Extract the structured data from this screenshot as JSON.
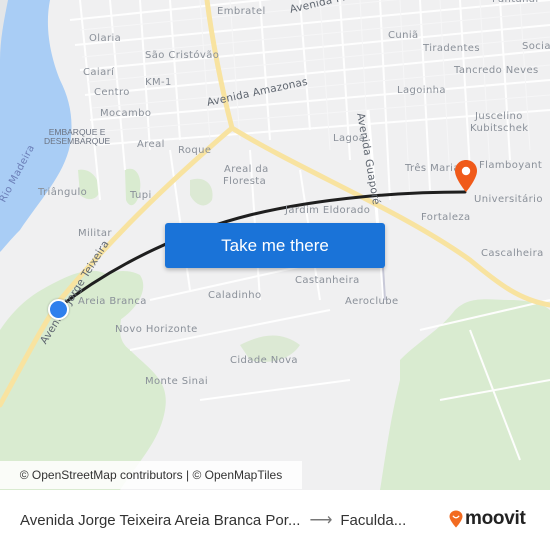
{
  "map": {
    "colors": {
      "background": "#f0f0f1",
      "water": "#a9cdf5",
      "park": "#d9ebd0",
      "major_road": "#f8e3a0",
      "route_line": "#1f1f1f",
      "origin_marker": "#2f80ed",
      "destination_marker": "#f05a1a",
      "button": "#1a73d8"
    },
    "labels": {
      "embratel": "Embratel",
      "av_pinheiro_machado": "Avenida Pinheiro Machado",
      "pantanal": "Pantanal",
      "olaria": "Olaria",
      "sao_cristovao": "São Cristóvão",
      "caiari": "Caiarí",
      "km1": "KM-1",
      "centro": "Centro",
      "av_amazonas": "Avenida Amazonas",
      "mocambo": "Mocambo",
      "embarque": "EMBARQUE E\nDESEMBARQUE",
      "areal": "Areal",
      "roque": "Roque",
      "cunia": "Cuniã",
      "tiradentes": "Tiradentes",
      "socia": "Socia",
      "tancredo_neves": "Tancredo Neves",
      "lagoinha": "Lagoinha",
      "juscelino": "Juscelino",
      "kubitschek": "Kubitschek",
      "lagoa": "Lagoa",
      "av_guapore": "Avenida Guaporé",
      "rio_madeira": "Rio Madeira",
      "triangulo": "Triângulo",
      "tupi": "Tupi",
      "areal_da": "Areal da",
      "floresta": "Floresta",
      "tres_marias": "Três Marias",
      "flamboyant": "Flamboyant",
      "universitario": "Universitário",
      "jardim_eldorado": "Jardim Eldorado",
      "fortaleza": "Fortaleza",
      "militar": "Militar",
      "av_jorge_teixeira": "Avenida Jorge Teixeira",
      "cascalheira": "Cascalheira",
      "castanheira": "Castanheira",
      "areia_branca": "Areia Branca",
      "caladinho": "Caladinho",
      "aeroclube": "Aeroclube",
      "novo_horizonte": "Novo Horizonte",
      "cidade_nova": "Cidade Nova",
      "monte_sinai": "Monte Sinai"
    },
    "action_button": "Take me there",
    "attribution": "© OpenStreetMap contributors | © OpenMapTiles"
  },
  "footer": {
    "origin": "Avenida Jorge Teixeira Areia Branca Por...",
    "arrow": "⟶",
    "destination": "Faculda...",
    "brand": "moovit"
  }
}
